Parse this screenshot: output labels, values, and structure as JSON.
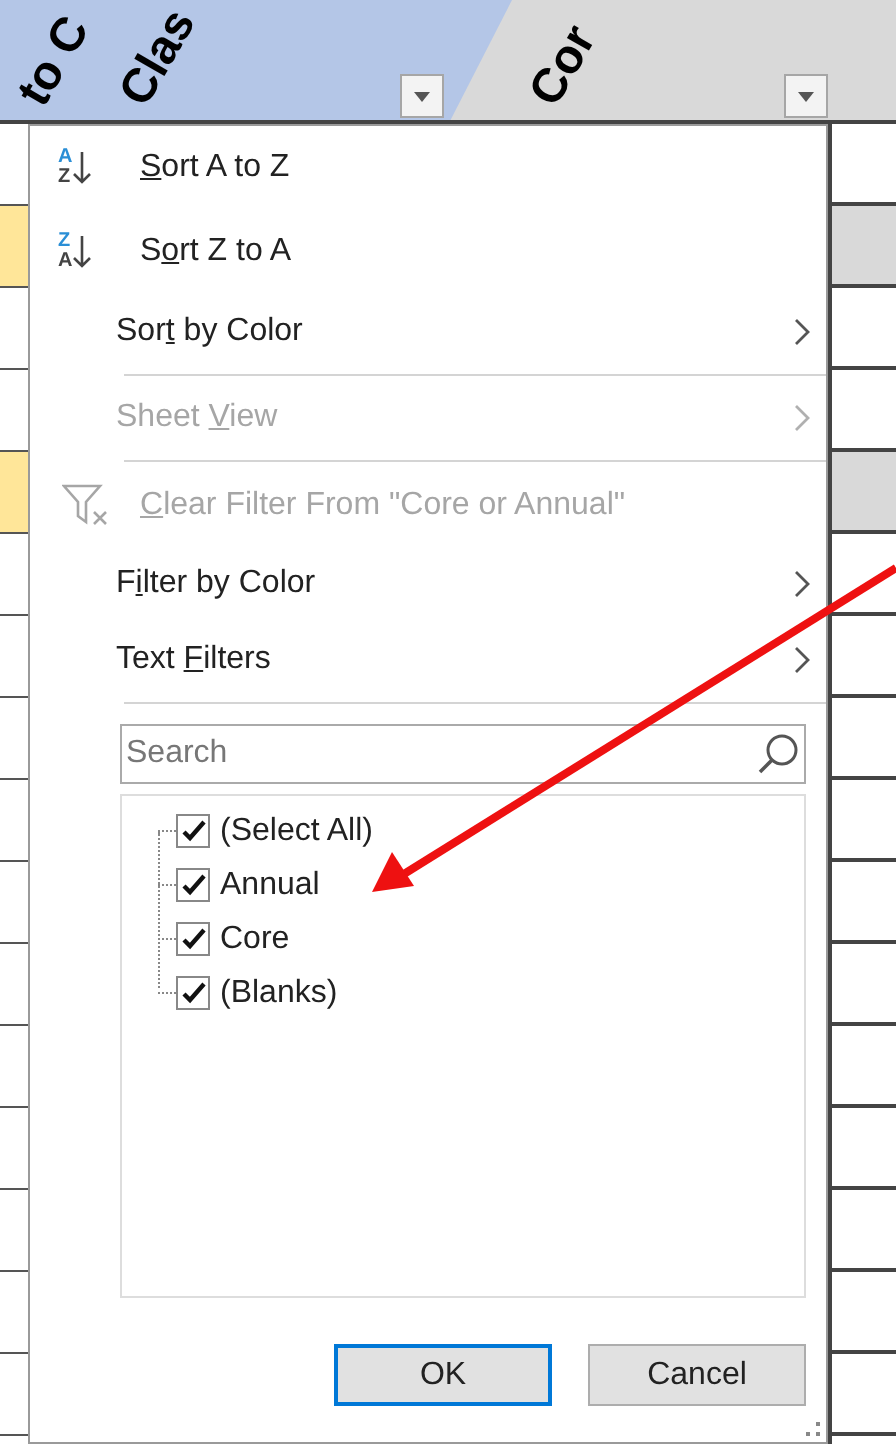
{
  "header": {
    "columns": [
      {
        "texts": [
          "to C",
          "Clas"
        ],
        "selected": true
      },
      {
        "texts": [
          "Cor"
        ],
        "selected": false
      }
    ]
  },
  "menu": [
    {
      "kind": "sort",
      "icon_letters": [
        "A",
        "Z"
      ],
      "key": "S",
      "after": "ort A to Z",
      "disabled": false
    },
    {
      "kind": "sort",
      "icon_letters": [
        "Z",
        "A"
      ],
      "before": "S",
      "key": "o",
      "after": "rt Z to A",
      "disabled": false
    },
    {
      "kind": "submenu",
      "before": "Sor",
      "key": "t",
      "after": " by Color",
      "disabled": false
    },
    {
      "kind": "divider"
    },
    {
      "kind": "submenu",
      "before": "Sheet ",
      "key": "V",
      "after": "iew",
      "disabled": true
    },
    {
      "kind": "divider"
    },
    {
      "kind": "clear",
      "key": "C",
      "after": "lear Filter From \"Core or Annual\"",
      "disabled": true
    },
    {
      "kind": "submenu",
      "before": "F",
      "key": "i",
      "after": "lter by Color",
      "disabled": false
    },
    {
      "kind": "submenu",
      "before": "Text ",
      "key": "F",
      "after": "ilters",
      "disabled": false
    },
    {
      "kind": "divider"
    }
  ],
  "search": {
    "placeholder": "Search"
  },
  "values": [
    {
      "label": "(Select All)",
      "checked": true
    },
    {
      "label": "Annual",
      "checked": true
    },
    {
      "label": "Core",
      "checked": true
    },
    {
      "label": "(Blanks)",
      "checked": true
    }
  ],
  "buttons": [
    {
      "label": "OK",
      "default": true
    },
    {
      "label": "Cancel",
      "default": false
    }
  ]
}
